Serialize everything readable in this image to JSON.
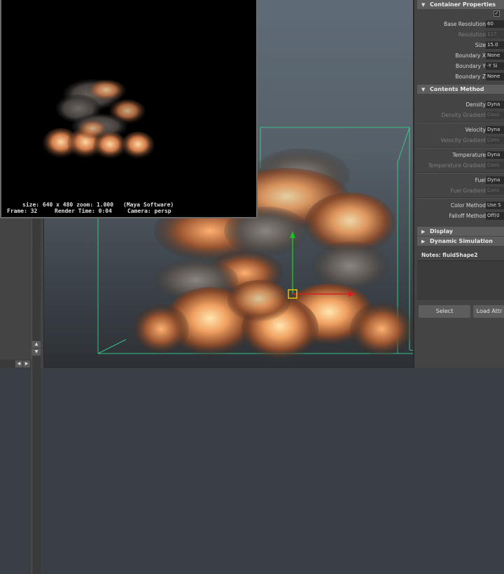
{
  "render_view": {
    "info_line1_left": "size: 640 x 480 zoom: 1.000",
    "info_line1_right": "(Maya Software)",
    "info_line2_frame": "Frame: 32",
    "info_line2_time": "Render Time: 0:04",
    "info_line2_camera": "Camera: persp"
  },
  "attribute_editor": {
    "sections": {
      "container_properties": "Container Properties",
      "contents_method": "Contents Method",
      "display": "Display",
      "dynamic_simulation": "Dynamic Simulation"
    },
    "checkbox_label": "Ke",
    "container_rows": [
      {
        "label": "Base Resolution",
        "value": "60",
        "dim": false
      },
      {
        "label": "Resolution",
        "value": "117",
        "dim": true
      },
      {
        "label": "Size",
        "value": "15.0",
        "dim": false
      },
      {
        "label": "Boundary X",
        "value": "None",
        "dim": false
      },
      {
        "label": "Boundary Y",
        "value": "-Y Si",
        "dim": false
      },
      {
        "label": "Boundary Z",
        "value": "None",
        "dim": false
      }
    ],
    "contents_rows": [
      {
        "label": "Density",
        "value": "Dyna"
      },
      {
        "label": "Density Gradient",
        "value": "Cons",
        "dim": true
      },
      {
        "label": "Velocity",
        "value": "Dyna"
      },
      {
        "label": "Velocity Gradient",
        "value": "Cons",
        "dim": true
      },
      {
        "label": "Temperature",
        "value": "Dyna"
      },
      {
        "label": "Temperature Gradient",
        "value": "Cons",
        "dim": true
      },
      {
        "label": "Fuel",
        "value": "Dyna"
      },
      {
        "label": "Fuel Gradient",
        "value": "Cons",
        "dim": true
      },
      {
        "label": "Color Method",
        "value": "Use S"
      },
      {
        "label": "Falloff Method",
        "value": "Off(0"
      }
    ],
    "notes_label": "Notes: fluidShape2",
    "select_button": "Select",
    "load_button": "Load Attr"
  },
  "colors": {
    "viewport_grid": "#3ccf8a",
    "manip_y": "#18c21f",
    "manip_x": "#d42020",
    "panel_bg": "#444444"
  }
}
